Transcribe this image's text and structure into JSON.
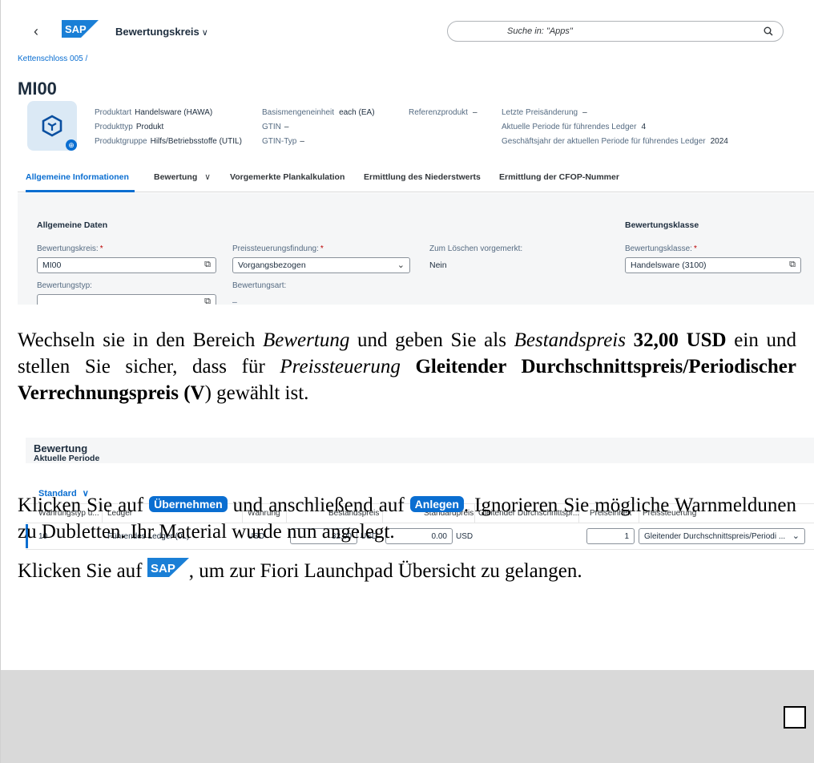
{
  "shell": {
    "back": "‹",
    "app_title": "Bewertungskreis",
    "title_chevron": "∨",
    "search_placeholder": "Suche in: \"Apps\""
  },
  "breadcrumb": "Kettenschloss 005 /",
  "object_title": "MI00",
  "header_attributes": [
    {
      "label": "Produktart",
      "value": "Handelsware (HAWA)"
    },
    {
      "label": "Produkttyp",
      "value": "Produkt"
    },
    {
      "label": "Produktgruppe",
      "value": "Hilfs/Betriebsstoffe (UTIL)"
    },
    {
      "label": "Basismengeneinheit",
      "value": "each (EA)"
    },
    {
      "label": "GTIN",
      "value": "–"
    },
    {
      "label": "GTIN-Typ",
      "value": "–"
    },
    {
      "label": "Referenzprodukt",
      "value": "–"
    },
    {
      "label": "Letzte Preisänderung",
      "value": "–"
    },
    {
      "label": "Aktuelle Periode für führendes Ledger",
      "value": "4"
    },
    {
      "label": "Geschäftsjahr der aktuellen Periode für führendes Ledger",
      "value": "2024"
    }
  ],
  "tabs": [
    {
      "label": "Allgemeine Informationen"
    },
    {
      "label": "Bewertung"
    },
    {
      "label": "Vorgemerkte Plankalkulation"
    },
    {
      "label": "Ermittlung des Niederstwerts"
    },
    {
      "label": "Ermittlung der CFOP-Nummer"
    }
  ],
  "tab_chevron": "∨",
  "general": {
    "heading": "Allgemeine Daten",
    "class_heading": "Bewertungsklasse",
    "bewertungskreis_label": "Bewertungskreis:",
    "bewertungskreis_value": "MI00",
    "preissteuerungsfindung_label": "Preissteuerungsfindung:",
    "preissteuerungsfindung_value": "Vorgangsbezogen",
    "loeschen_label": "Zum Löschen vorgemerkt:",
    "loeschen_value": "Nein",
    "bewertungsklasse_label": "Bewertungsklasse:",
    "bewertungsklasse_value": "Handelsware (3100)",
    "bewertungstyp_label": "Bewertungstyp:",
    "bewertungstyp_value": "",
    "bewertungsart_label": "Bewertungsart:",
    "bewertungsart_value": "–",
    "required_marker": "*"
  },
  "instruction1": {
    "t1": "Wechseln sie in den Bereich ",
    "t2": "Bewertung",
    "t3": " und geben Sie als ",
    "t4": "Bestandspreis",
    "t5": " ",
    "t6": "32,00 USD",
    "t7": " ein und stellen Sie sicher, dass für ",
    "t8": "Preissteuerung",
    "t9": " ",
    "t10": "Gleitender Durchschnittspreis/Periodischer Verrechnungspreis (V",
    "t11": ") gewählt ist."
  },
  "valuation": {
    "title": "Bewertung",
    "subtitle": "Aktuelle Periode",
    "standard_label": "Standard",
    "columns": [
      "Währungstyp u...",
      "Ledger",
      "Währung",
      "Bestandspreis",
      "Standardpreis",
      "Gleitender Durchschnittspr...",
      "Preiseinheit",
      "Preissteuerung"
    ],
    "row": {
      "currency_type": "10",
      "ledger": "Führendes Ledger (0L)",
      "currency": "USD",
      "stock_price": "32.00",
      "stock_price_unit": "USD",
      "standard_price": "0.00",
      "standard_price_unit": "USD",
      "price_unit": "1",
      "price_control": "Gleitender Durchschnittspreis/Periodi ..."
    }
  },
  "instruction2": {
    "t1": "Klicken Sie auf ",
    "button1": "Übernehmen",
    "t2": " und anschließend auf ",
    "button2": "Anlegen",
    "t3": ".  Ignorieren Sie mögliche Warnmeldunen zu Dubletten. Ihr Material wurde nun angelegt."
  },
  "instruction3": {
    "t1": "Klicken Sie auf ",
    "t2": ", um zur Fiori Launchpad Übersicht zu gelangen."
  },
  "logo_text": "SAP",
  "colors": {
    "accent": "#0a6ed1",
    "logo": "#1a7fd6",
    "footer": "#d9d9d9"
  }
}
